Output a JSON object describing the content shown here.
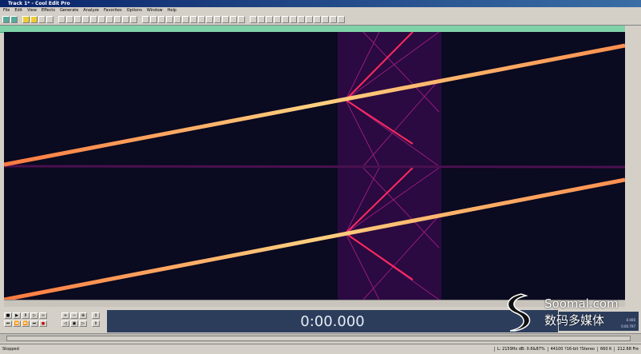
{
  "window": {
    "title": "Track 1* - Cool Edit Pro"
  },
  "menu": {
    "items": [
      "File",
      "Edit",
      "View",
      "Effects",
      "Generate",
      "Analyze",
      "Favorites",
      "Options",
      "Window",
      "Help"
    ]
  },
  "transport": {
    "time_display": "0:00.000"
  },
  "readout": {
    "line1": "0.000",
    "line2": "0:00.797"
  },
  "status": {
    "left": "Stopped",
    "cells": [
      "L: 2159Hz dB: 0.6&87%",
      "44100 ?16-bit ?Stereo",
      "660 K",
      "212.68 Fre"
    ]
  },
  "watermark": {
    "line1": "Soomal.com",
    "line2": "数码多媒体"
  },
  "colors": {
    "background": "#0a0a20",
    "line": "#ffb060",
    "hot": "#ff2a60",
    "overview": "#7fd1a8",
    "timer_bg": "#2c3d5c"
  }
}
